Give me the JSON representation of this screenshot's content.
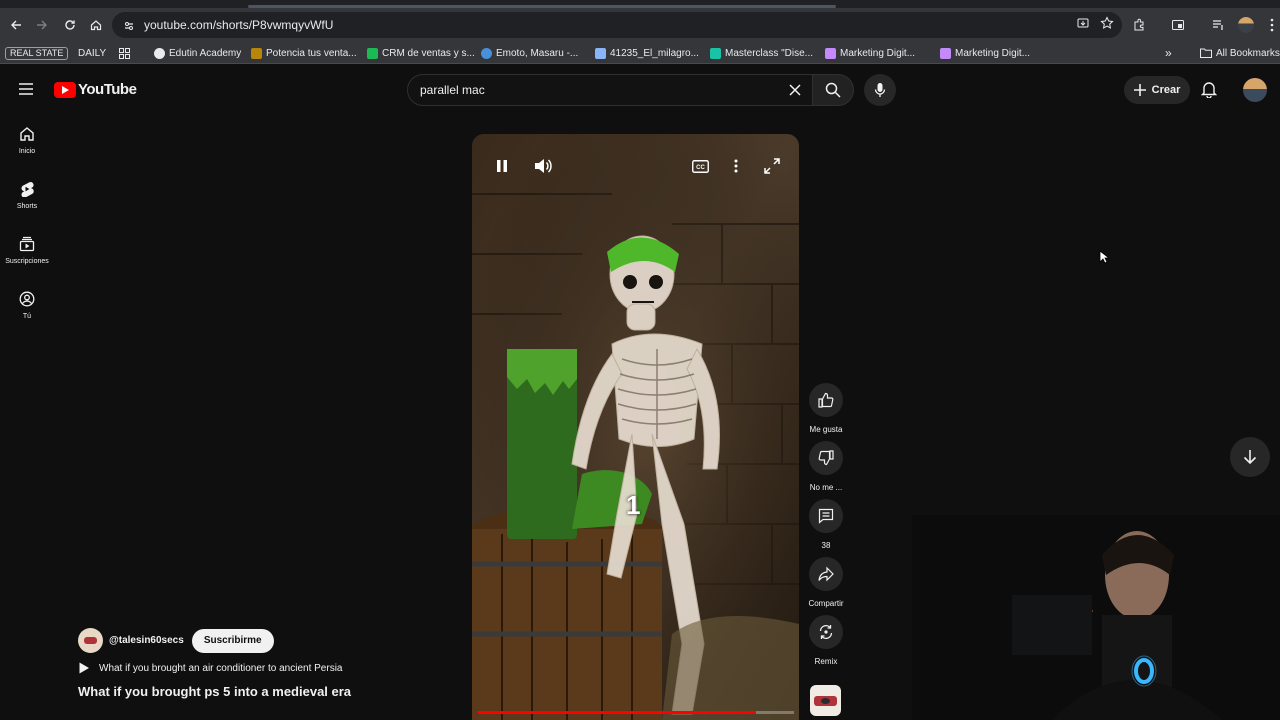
{
  "browser": {
    "url": "youtube.com/shorts/P8vwmqyvWfU",
    "bookmarks": [
      {
        "label": "REAL STATE",
        "kind": "tag"
      },
      {
        "label": "DAILY",
        "kind": "plain"
      },
      {
        "label": "Edutin Academy",
        "kind": "site"
      },
      {
        "label": "Potencia tus venta...",
        "kind": "site"
      },
      {
        "label": "CRM de ventas y s...",
        "kind": "site"
      },
      {
        "label": "Emoto, Masaru -...",
        "kind": "site"
      },
      {
        "label": "41235_El_milagro...",
        "kind": "site"
      },
      {
        "label": "Masterclass \"Dise...",
        "kind": "site"
      },
      {
        "label": "Marketing Digit...",
        "kind": "site"
      },
      {
        "label": "Marketing Digit...",
        "kind": "site"
      }
    ],
    "all_bookmarks": "All Bookmarks"
  },
  "youtube": {
    "logo_text": "YouTube",
    "search_value": "parallel mac",
    "create_label": "Crear",
    "sidebar": [
      {
        "label": "Inicio",
        "icon": "home-icon"
      },
      {
        "label": "Shorts",
        "icon": "shorts-icon"
      },
      {
        "label": "Suscripciones",
        "icon": "subscriptions-icon"
      },
      {
        "label": "Tú",
        "icon": "you-icon"
      }
    ],
    "actions": {
      "like": "Me gusta",
      "dislike": "No me ...",
      "comments": "38",
      "share": "Compartir",
      "remix": "Remix"
    },
    "video": {
      "caption_digit": "1",
      "progress": 0.88
    },
    "channel": {
      "handle": "@talesin60secs",
      "subscribe": "Suscribirme"
    },
    "related_video": "What if you brought an air conditioner to ancient Persia",
    "title": "What if you brought ps 5 into a medieval era"
  },
  "colors": {
    "accent": "#ff0000",
    "background": "#0f0f0f"
  }
}
